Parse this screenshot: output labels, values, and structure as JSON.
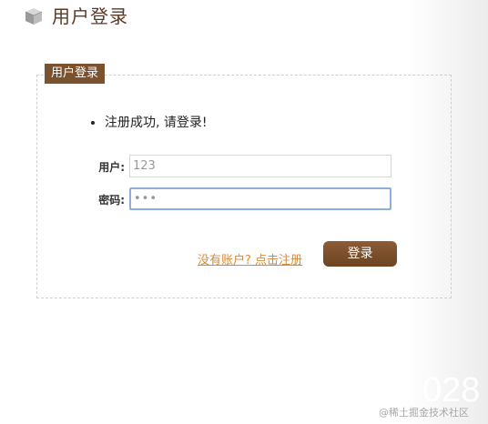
{
  "page": {
    "title": "用户登录"
  },
  "login_box": {
    "legend": "用户登录",
    "messages": [
      "注册成功, 请登录!"
    ],
    "username_label": "用户:",
    "username_value": "123",
    "password_label": "密码:",
    "password_value": "•••",
    "register_link": "没有账户? 点击注册",
    "login_button": "登录"
  },
  "watermark": {
    "number": "028",
    "text": "@稀土掘金技术社区"
  },
  "colors": {
    "accent_brown": "#7a5230",
    "link_orange": "#d88a3a",
    "focus_blue": "#8eaedc"
  }
}
